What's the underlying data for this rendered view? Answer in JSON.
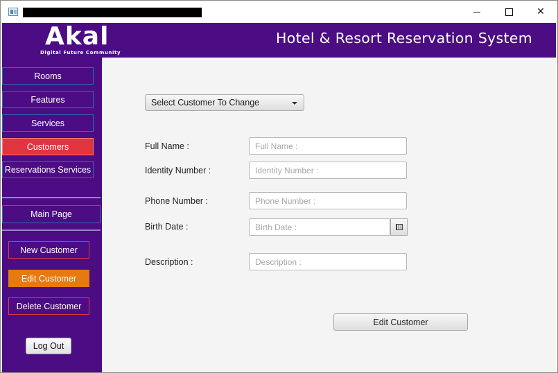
{
  "window": {
    "controls": {
      "minimize": "—",
      "maximize": "☐",
      "close": "✕"
    }
  },
  "header": {
    "logo": "Akal",
    "logo_tagline": "Digital Future Community",
    "title": "Hotel & Resort Reservation System"
  },
  "sidebar": {
    "nav": [
      {
        "label": "Rooms",
        "active": false
      },
      {
        "label": "Features",
        "active": false
      },
      {
        "label": "Services",
        "active": false
      },
      {
        "label": "Customers",
        "active": true
      },
      {
        "label": "Reservations Services",
        "active": false
      }
    ],
    "main_page": "Main Page",
    "actions": [
      {
        "label": "New Customer",
        "active": false
      },
      {
        "label": "Edit Customer",
        "active": true
      },
      {
        "label": "Delete Customer",
        "active": false
      }
    ],
    "logout": "Log Out"
  },
  "form": {
    "customer_select": "Select Customer To Change",
    "fields": {
      "full_name": {
        "label": "Full Name :",
        "placeholder": "Full Name :"
      },
      "identity_number": {
        "label": "Identity Number :",
        "placeholder": "Identity Number :"
      },
      "phone_number": {
        "label": "Phone Number :",
        "placeholder": "Phone Number :"
      },
      "birth_date": {
        "label": "Birth Date :",
        "placeholder": "Birth Date :"
      },
      "description": {
        "label": "Description :",
        "placeholder": "Description :"
      }
    },
    "submit": "Edit Customer"
  },
  "colors": {
    "brand_purple": "#4b0c84",
    "active_nav": "#e0353f",
    "active_action": "#e67a0f",
    "panel_bg": "#f4f4f4"
  }
}
